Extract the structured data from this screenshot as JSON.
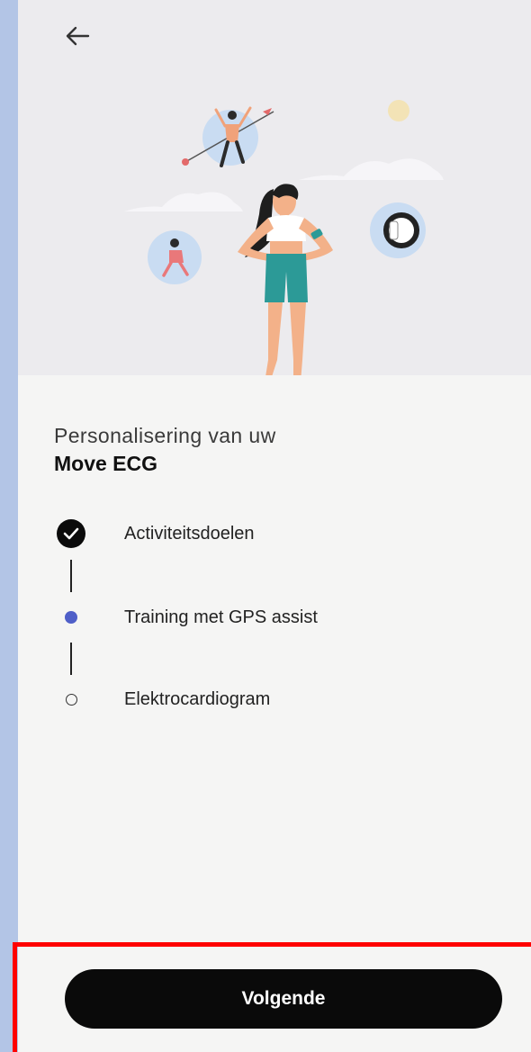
{
  "header": {
    "back_icon": "arrow-left-icon"
  },
  "setup": {
    "subtitle": "Personalisering van uw",
    "device_name": "Move ECG"
  },
  "steps": [
    {
      "label": "Activiteitsdoelen",
      "state": "completed",
      "icon": "check-icon"
    },
    {
      "label": "Training met GPS assist",
      "state": "current",
      "icon": "dot-filled-icon"
    },
    {
      "label": "Elektrocardiogram",
      "state": "pending",
      "icon": "dot-outline-icon"
    }
  ],
  "footer": {
    "next_label": "Volgende"
  },
  "colors": {
    "accent": "#4f5fc8",
    "button": "#0a0a0a",
    "highlight_border": "#ff0000",
    "hero_bg": "#ecebee",
    "page_bg": "#f5f5f4",
    "left_strip": "#b3c5e6"
  }
}
